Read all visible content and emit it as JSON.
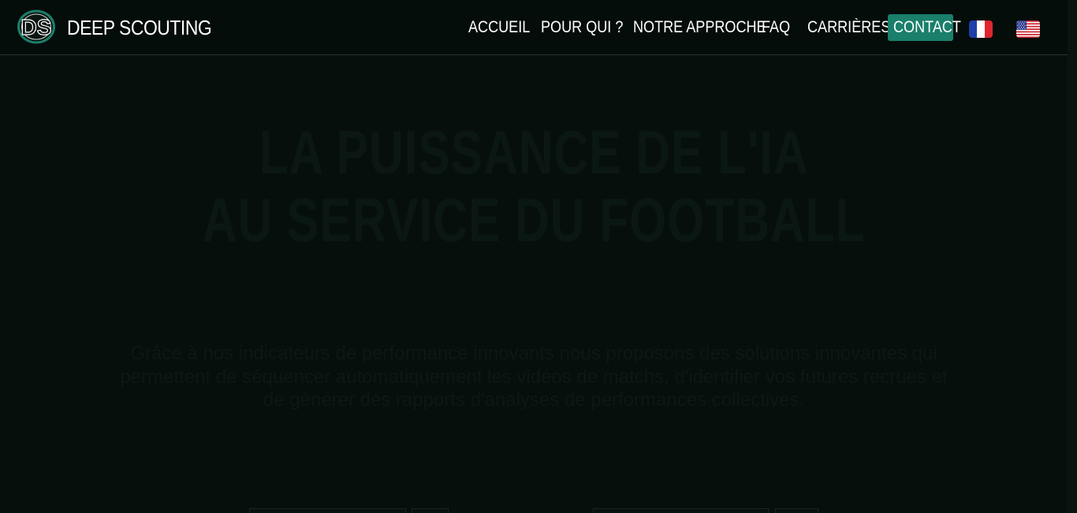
{
  "brand": {
    "logo_letters": "DS",
    "name": "DEEP SCOUTING"
  },
  "nav": {
    "items": [
      {
        "label": "ACCUEIL"
      },
      {
        "label": "POUR QUI ?"
      },
      {
        "label": "NOTRE APPROCHE"
      },
      {
        "label": "FAQ"
      },
      {
        "label": "CARRIÈRES"
      }
    ],
    "contact_label": "CONTACT",
    "languages": [
      "french-flag-icon",
      "us-flag-icon"
    ]
  },
  "hero": {
    "title_line1": "LA PUISSANCE DE L'IA",
    "title_line2": "AU SERVICE DU FOOTBALL",
    "description": "Grâce à nos indicateurs de performance innovants nous proposons des solutions innovantes qui permettent de séquencer automatiquement les vidéos de matchs, d'identifier vos futures recrues et de générer des rapports d'analyses de performances collectives."
  },
  "colors": {
    "background": "#060f0c",
    "accent": "#1a7f6b",
    "text": "#ffffff"
  }
}
